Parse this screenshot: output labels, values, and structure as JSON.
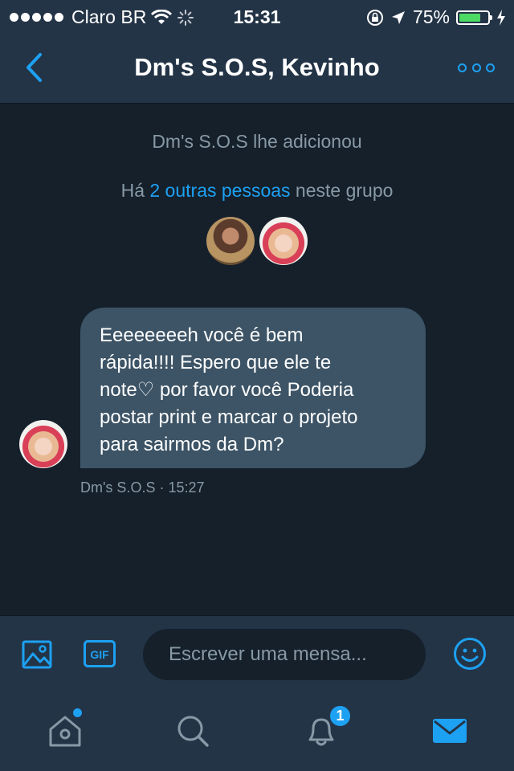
{
  "status_bar": {
    "carrier": "Claro BR",
    "time": "15:31",
    "battery": "75%",
    "battery_level": 0.75
  },
  "header": {
    "title": "Dm's S.O.S, Kevinho"
  },
  "conversation": {
    "added_notice": "Dm's S.O.S lhe adicionou",
    "group_prefix": "Há ",
    "group_link": "2 outras pessoas",
    "group_suffix": " neste grupo"
  },
  "message": {
    "text": "Eeeeeeeeh você é bem\nrápida!!!! Espero que ele te\nnote♡ por favor você Poderia\npostar print e marcar o projeto\npara sairmos da Dm?",
    "sender": "Dm's S.O.S",
    "time": "15:27"
  },
  "composer": {
    "placeholder": "Escrever uma mensa...",
    "gif_label": "GIF"
  },
  "tabs": {
    "notifications_badge": "1"
  },
  "colors": {
    "accent": "#1da1f2",
    "background": "#15202b",
    "bar": "#243447",
    "bubble": "#3d5466",
    "muted_text": "#8899a6",
    "battery": "#4cd964"
  }
}
